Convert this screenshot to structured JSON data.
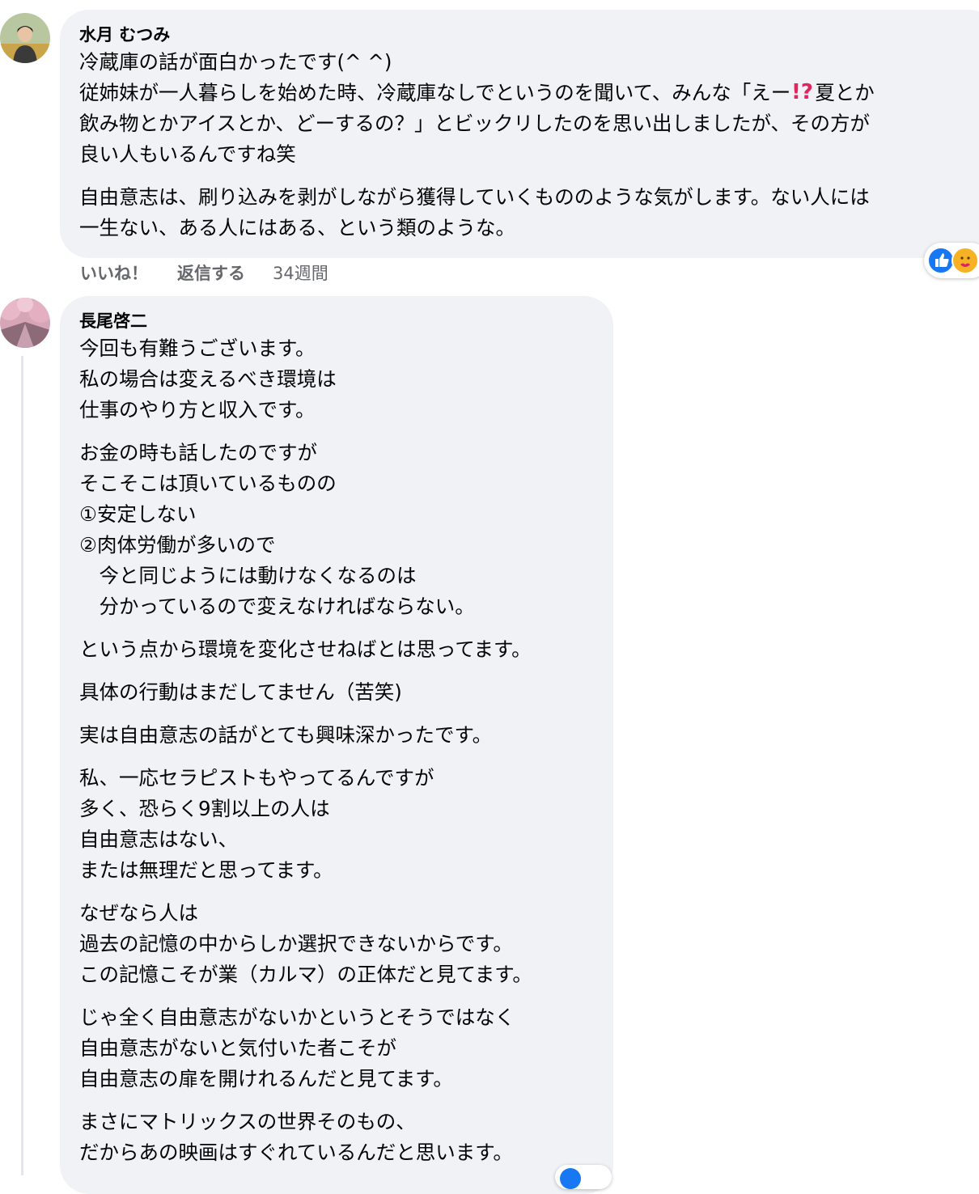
{
  "colors": {
    "bubble_bg": "#f0f2f5",
    "secondary_text": "#65676b",
    "like_blue": "#1877f2",
    "care_yellow": "#f7b125",
    "emoji_red": "#e0245e"
  },
  "comment1": {
    "author": "水月 むつみ",
    "avatar": "user-avatar-photo",
    "paragraphs": [
      [
        "冷蔵庫の話が面白かったです(^ ^)",
        "従姉妹が一人暮らしを始めた時、冷蔵庫なしでというのを聞いて、みんな「えー",
        "飲み物とかアイスとか、どーするの？」とビックリしたのを思い出しましたが、その方が",
        "良い人もいるんですね笑"
      ],
      [
        "自由意志は、刷り込みを剥がしながら獲得していくもののような気がします。ない人には",
        "一生ない、ある人にはある、という類のような。"
      ]
    ],
    "line2_emoji": "⁉️",
    "line2_after": "夏とか",
    "actions": {
      "like": "いいね！",
      "reply": "返信する",
      "time": "34週間"
    },
    "reactions": [
      "like-icon",
      "care-icon"
    ]
  },
  "comment2": {
    "author": "長尾啓二",
    "avatar": "user-avatar-cherry-blossom",
    "paragraphs": [
      [
        "今回も有難うございます。",
        "私の場合は変えるべき環境は",
        "仕事のやり方と収入です。"
      ],
      [
        "お金の時も話したのですが",
        "そこそこは頂いているものの",
        "①安定しない",
        "②肉体労働が多いので",
        "　今と同じようには動けなくなるのは",
        "　分かっているので変えなければならない。"
      ],
      [
        "という点から環境を変化させねばとは思ってます。"
      ],
      [
        "具体の行動はまだしてません（苦笑)"
      ],
      [
        "実は自由意志の話がとても興味深かったです。"
      ],
      [
        "私、一応セラピストもやってるんですが",
        "多く、恐らく9割以上の人は",
        "自由意志はない、",
        "または無理だと思ってます。"
      ],
      [
        "なぜなら人は",
        "過去の記憶の中からしか選択できないからです。",
        "この記憶こそが業（カルマ）の正体だと見てます。"
      ],
      [
        "じゃ全く自由意志がないかというとそうではなく",
        "自由意志がないと気付いた者こそが",
        "自由意志の扉を開けれるんだと見てます。"
      ],
      [
        "まさにマトリックスの世界そのもの、",
        "だからあの映画はすぐれているんだと思います。"
      ]
    ]
  }
}
